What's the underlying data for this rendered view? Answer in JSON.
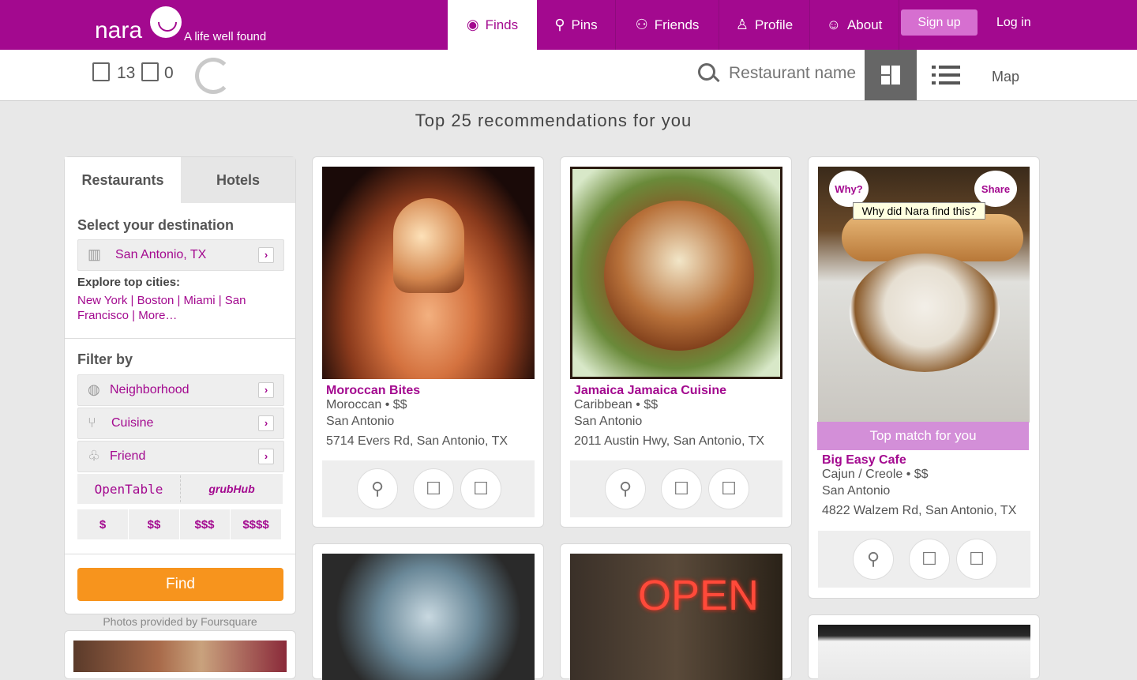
{
  "brand": {
    "logo_text": "nara",
    "tagline": "A life well found",
    "color": "#a3098f"
  },
  "nav": {
    "items": [
      {
        "label": "Finds",
        "icon": "eye-icon",
        "active": true
      },
      {
        "label": "Pins",
        "icon": "pin-icon",
        "active": false
      },
      {
        "label": "Friends",
        "icon": "friends-icon",
        "active": false
      },
      {
        "label": "Profile",
        "icon": "profile-icon",
        "active": false
      },
      {
        "label": "About",
        "icon": "chat-icon",
        "active": false
      }
    ],
    "signup": "Sign up",
    "login": "Log in"
  },
  "toolbar": {
    "count_left": "13",
    "count_right": "0",
    "search_placeholder": "Restaurant name",
    "map_label": "Map"
  },
  "heading": "Top 25 recommendations for you",
  "sidebar": {
    "tabs": [
      "Restaurants",
      "Hotels"
    ],
    "destination_title": "Select your destination",
    "destination_value": "San Antonio, TX",
    "explore_title": "Explore top cities:",
    "cities_text": "New York | Boston | Miami | San Francisco | More…",
    "filter_title": "Filter by",
    "filters": [
      "Neighborhood",
      "Cuisine",
      "Friend"
    ],
    "opentable": "OpenTable",
    "grubhub": "grubHub",
    "prices": [
      "$",
      "$$",
      "$$$",
      "$$$$"
    ],
    "find_label": "Find",
    "photo_credit": "Photos provided by Foursquare"
  },
  "cards": [
    {
      "name": "Moroccan Bites",
      "cuisine": "Moroccan • $$",
      "city": "San Antonio",
      "address": "5714 Evers Rd, San Antonio, TX"
    },
    {
      "name": "Jamaica Jamaica Cuisine",
      "cuisine": "Caribbean • $$",
      "city": "San Antonio",
      "address": "2011 Austin Hwy, San Antonio, TX"
    },
    {
      "name": "Big Easy Cafe",
      "cuisine": "Cajun / Creole • $$",
      "city": "San Antonio",
      "address": "4822 Walzem Rd, San Antonio, TX",
      "why": "Why?",
      "share": "Share",
      "tooltip": "Why did Nara find this?",
      "top_match": "Top match for you"
    }
  ],
  "open_sign_text": "OPEN"
}
